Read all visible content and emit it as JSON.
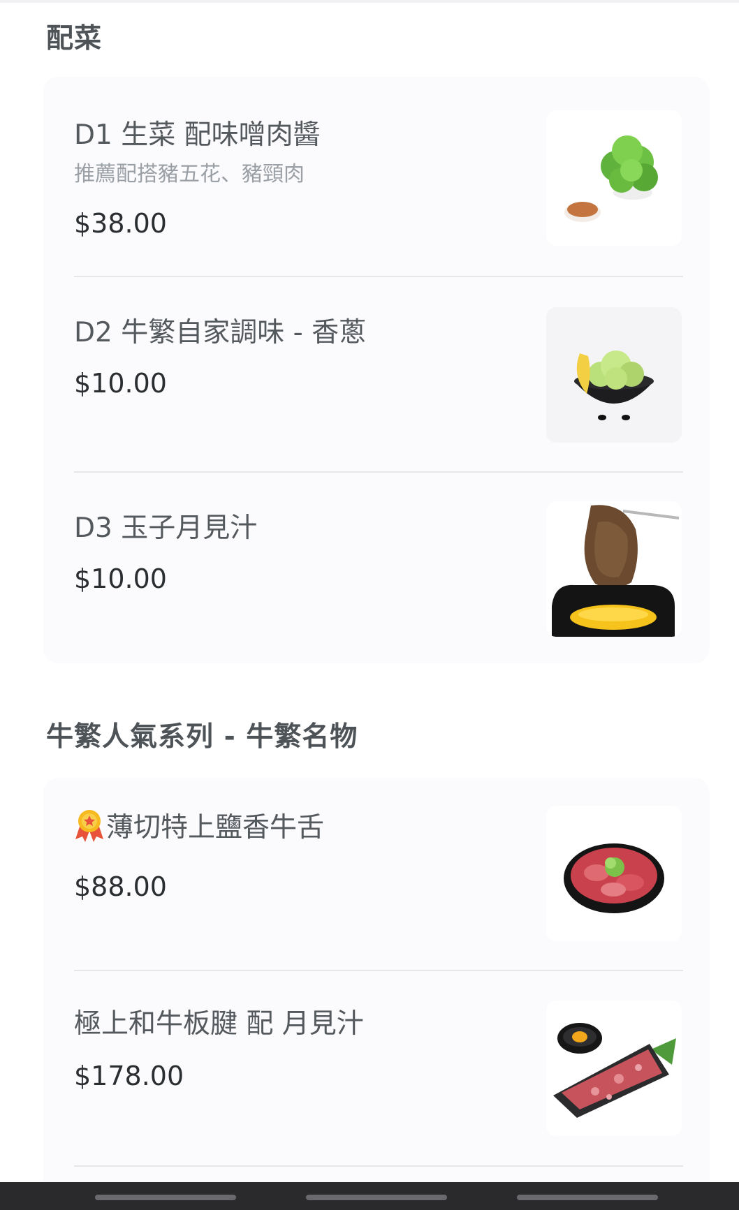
{
  "sections": [
    {
      "title": "配菜",
      "items": [
        {
          "name": "D1 生菜 配味噌肉醬",
          "desc": "推薦配搭豬五花、豬頸肉",
          "price": "$38.00",
          "image": "lettuce-with-miso-sauce"
        },
        {
          "name": "D2 牛繁自家調味 - 香蔥",
          "price": "$10.00",
          "image": "scallion-bowl-with-lemon"
        },
        {
          "name": "D3 玉子月見汁",
          "price": "$10.00",
          "image": "meat-dipped-in-egg-yolk"
        }
      ]
    },
    {
      "title": "牛繁人氣系列 - 牛繁名物",
      "items": [
        {
          "name": "薄切特上鹽香牛舌",
          "price": "$88.00",
          "image": "sliced-beef-tongue-plate",
          "badge": "medal-icon"
        },
        {
          "name": "極上和牛板腱 配 月見汁",
          "price": "$178.00",
          "image": "wagyu-slices-with-egg-dip"
        }
      ]
    }
  ],
  "colors": {
    "section_title": "#4e5358",
    "item_name": "#54595e",
    "item_desc": "#9aa0a5",
    "price": "#2b2e31",
    "card_bg": "#fbfafc",
    "nav_bar": "#2a2a2c"
  }
}
